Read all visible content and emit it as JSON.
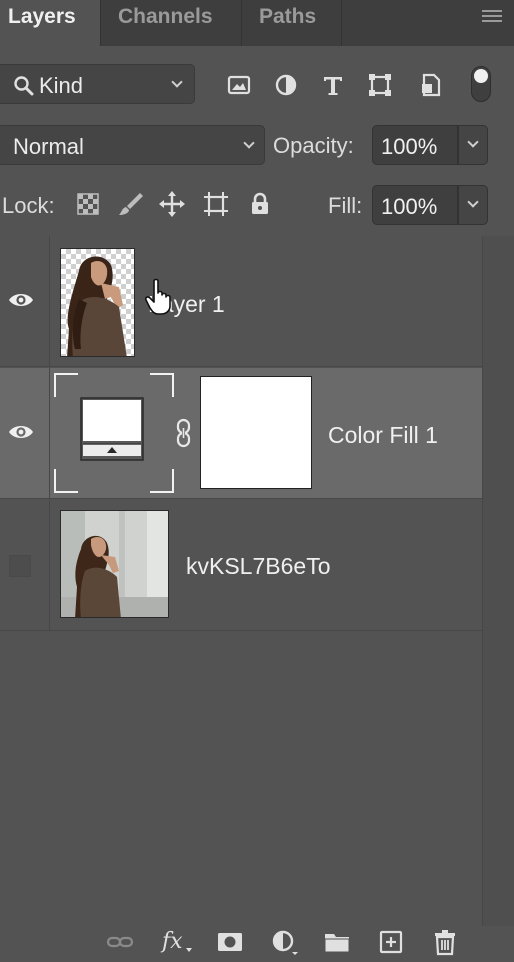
{
  "tabs": {
    "layers": "Layers",
    "channels": "Channels",
    "paths": "Paths"
  },
  "filter": {
    "kind_label": "Kind",
    "icons": [
      "image-filter-icon",
      "adjustment-filter-icon",
      "type-filter-icon",
      "shape-filter-icon",
      "smart-object-filter-icon"
    ]
  },
  "blend": {
    "mode": "Normal",
    "opacity_label": "Opacity:",
    "opacity_value": "100%"
  },
  "lock": {
    "label": "Lock:",
    "fill_label": "Fill:",
    "fill_value": "100%",
    "icons": [
      "lock-transparent-pixels-icon",
      "lock-image-pixels-icon",
      "lock-position-icon",
      "lock-artboard-icon",
      "lock-all-icon"
    ]
  },
  "layers": [
    {
      "name": "Layer 1",
      "visible": true,
      "selected": false
    },
    {
      "name": "Color Fill 1",
      "visible": true,
      "selected": true
    },
    {
      "name": "kvKSL7B6eTo",
      "visible": false,
      "selected": false
    }
  ],
  "footer": {
    "icons": [
      "link-layers-icon",
      "fx-icon",
      "add-mask-icon",
      "new-adjustment-icon",
      "new-group-icon",
      "new-layer-icon",
      "delete-layer-icon"
    ],
    "fx_text": "fx"
  },
  "colors": {
    "panel_bg": "#535353",
    "tab_bar_bg": "#3e3e3e",
    "selected_row": "#6a6a6a",
    "text": "#e6e6e6",
    "fill_color": "#ffffff"
  }
}
